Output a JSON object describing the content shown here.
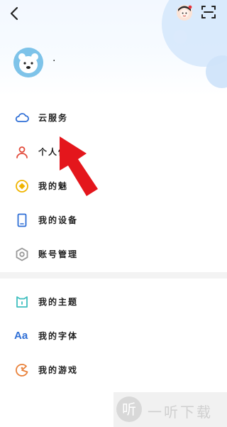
{
  "header": {
    "back_icon": "back-arrow-icon",
    "avatar_icon": "user-avatar-icon",
    "scan_icon": "scan-icon",
    "profile_avatar": "bear-avatar",
    "username": "·"
  },
  "menu_group_1": [
    {
      "label": "云服务",
      "icon": "cloud-icon",
      "color": "#2f6fd6"
    },
    {
      "label": "个人信息",
      "icon": "person-icon",
      "color": "#e24a3a"
    },
    {
      "label": "我的魅",
      "icon": "coin-icon",
      "color": "#f0b400"
    },
    {
      "label": "我的设备",
      "icon": "phone-icon",
      "color": "#2f6fd6"
    },
    {
      "label": "账号管理",
      "icon": "gear-icon",
      "color": "#999999"
    }
  ],
  "menu_group_2": [
    {
      "label": "我的主题",
      "icon": "theme-icon",
      "color": "#3fbfbf"
    },
    {
      "label": "我的字体",
      "icon": "font-icon",
      "color": "#2f6fd6"
    },
    {
      "label": "我的游戏",
      "icon": "game-icon",
      "color": "#e9813a"
    }
  ],
  "font_icon_text": "Aa",
  "annotation": {
    "arrow_color": "#e4161c"
  },
  "watermark": {
    "glyph": "听",
    "text": "一听下载"
  }
}
